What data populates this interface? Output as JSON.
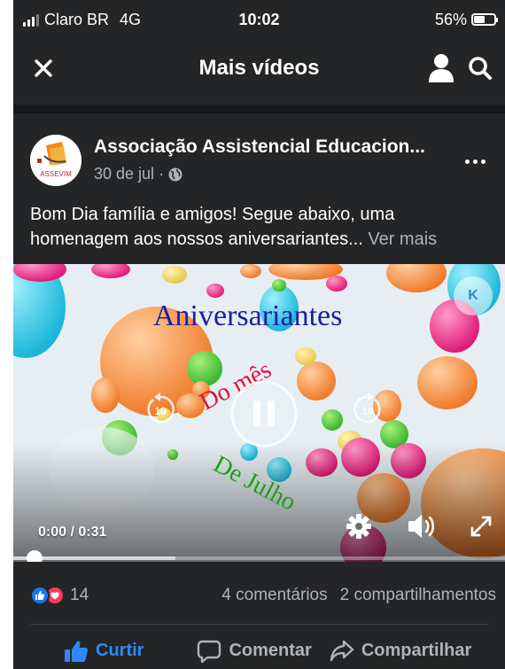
{
  "status_bar": {
    "carrier": "Claro BR",
    "network": "4G",
    "time": "10:02",
    "battery": "56%",
    "battery_level": 0.56
  },
  "navbar": {
    "title": "Mais vídeos",
    "icons": [
      "close-icon",
      "profile-icon",
      "search-icon"
    ]
  },
  "post": {
    "page_name": "Associação Assistencial Educacion...",
    "avatar_text": "ASSEVIM",
    "date": "30 de jul",
    "date_separator": "·",
    "privacy_icon": "globe-icon",
    "text_line1": "Bom Dia família e amigos! Segue abaixo, uma",
    "text_line2": "homenagem aos nossos aniversariantes...",
    "see_more": "Ver mais"
  },
  "video": {
    "overlay_title": "Aniversariantes",
    "overlay_line2": "Do mês",
    "overlay_line3": "De Julho",
    "watermark": "K",
    "current_time": "0:00",
    "time_separator": "/",
    "duration": "0:31",
    "skip_back_seconds": "10",
    "skip_forward_seconds": "10",
    "progress_fraction": 0.0,
    "buffered_fraction": 0.33,
    "colors": {
      "title": "#1d1fa3",
      "line2": "#e0103a",
      "line3": "#1aa01a"
    }
  },
  "reactions": {
    "icons": [
      "like-reaction-icon",
      "love-reaction-icon"
    ],
    "count": "14",
    "comments": "4 comentários",
    "shares": "2 compartilhamentos"
  },
  "actions": {
    "like": "Curtir",
    "comment": "Comentar",
    "share": "Compartilhar",
    "like_color": "#2d88ff"
  }
}
